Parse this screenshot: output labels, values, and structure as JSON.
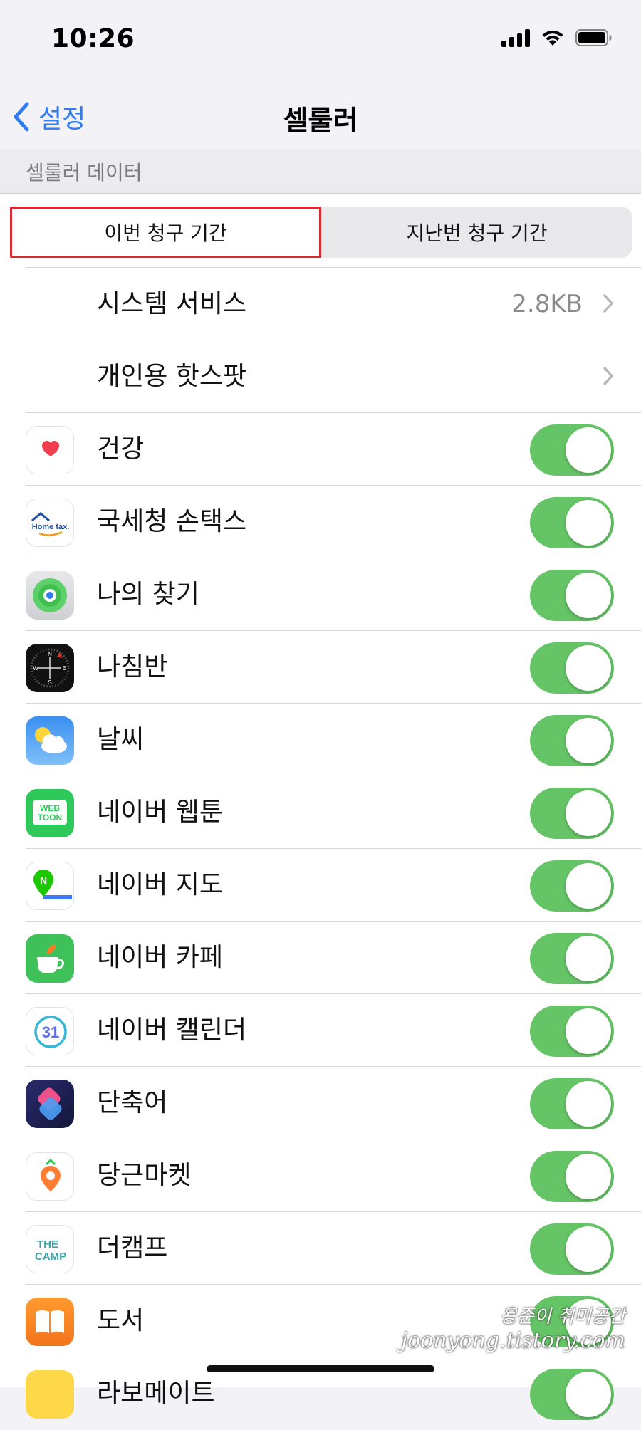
{
  "status_bar": {
    "time": "10:26"
  },
  "nav": {
    "back_label": "설정",
    "title": "셀룰러"
  },
  "section_header": "셀룰러 데이터",
  "segmented": {
    "current": "이번 청구 기간",
    "previous": "지난번 청구 기간"
  },
  "system_rows": [
    {
      "label": "시스템 서비스",
      "value": "2.8KB"
    },
    {
      "label": "개인용 핫스팟",
      "value": ""
    }
  ],
  "apps": [
    {
      "name": "건강",
      "icon": "health-icon",
      "enabled": true
    },
    {
      "name": "국세청 손택스",
      "icon": "hometax-icon",
      "enabled": true
    },
    {
      "name": "나의 찾기",
      "icon": "find-my-icon",
      "enabled": true
    },
    {
      "name": "나침반",
      "icon": "compass-icon",
      "enabled": true
    },
    {
      "name": "날씨",
      "icon": "weather-icon",
      "enabled": true
    },
    {
      "name": "네이버 웹툰",
      "icon": "naver-webtoon-icon",
      "enabled": true
    },
    {
      "name": "네이버 지도",
      "icon": "naver-map-icon",
      "enabled": true
    },
    {
      "name": "네이버 카페",
      "icon": "naver-cafe-icon",
      "enabled": true
    },
    {
      "name": "네이버 캘린더",
      "icon": "naver-calendar-icon",
      "enabled": true
    },
    {
      "name": "단축어",
      "icon": "shortcuts-icon",
      "enabled": true
    },
    {
      "name": "당근마켓",
      "icon": "daangn-market-icon",
      "enabled": true
    },
    {
      "name": "더캠프",
      "icon": "thecamp-icon",
      "enabled": true
    },
    {
      "name": "도서",
      "icon": "books-icon",
      "enabled": true
    },
    {
      "name": "라보메이트",
      "icon": "app-icon",
      "enabled": true
    }
  ],
  "icon_text": {
    "hometax": "Home tax.",
    "webtoon_1": "WEB",
    "webtoon_2": "TOON",
    "calendar_day": "31",
    "thecamp_1": "THE",
    "thecamp_2": "CAMP",
    "compass_n": "N",
    "compass_s": "S",
    "compass_e": "E",
    "compass_w": "W",
    "naver_map_letter": "N"
  },
  "watermark": {
    "line1": "용준이 취미공간",
    "line2": "joonyong.tistory.com"
  },
  "colors": {
    "accent": "#2f7bf5",
    "toggle_on": "#65c466",
    "highlight_box": "#d92a31"
  }
}
